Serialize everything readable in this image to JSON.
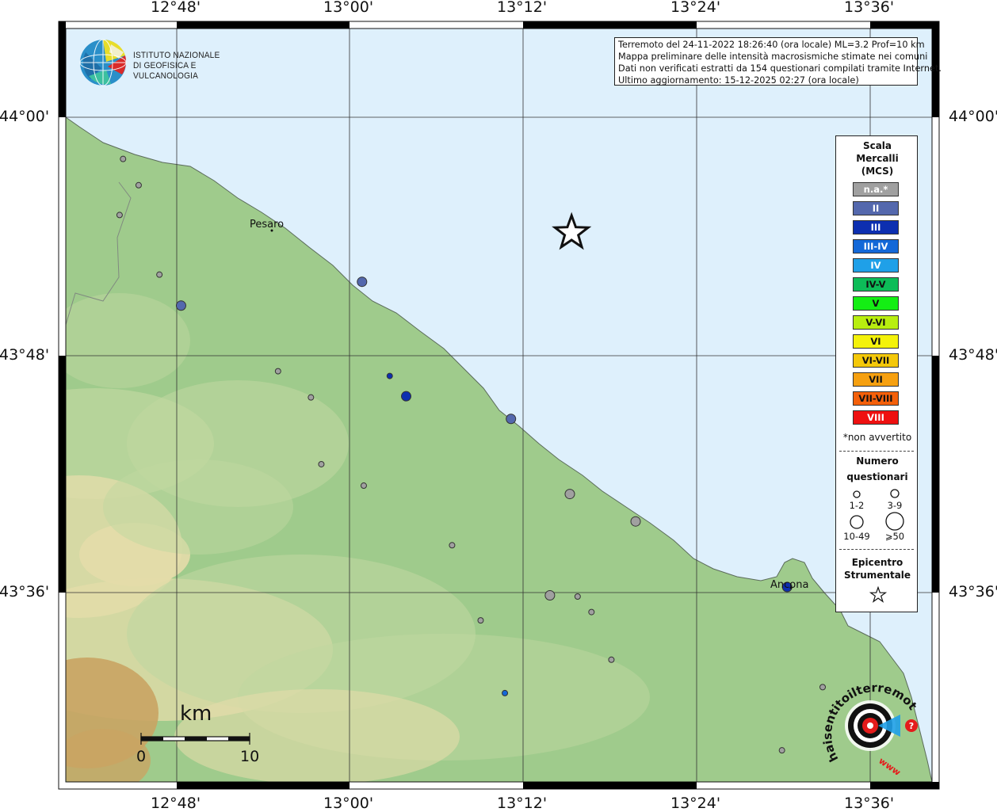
{
  "info_box": {
    "lines": [
      "Terremoto del 24-11-2022 18:26:40 (ora locale) ML=3.2 Prof=10 km",
      "Mappa preliminare delle intensità macrosismiche stimate nei comuni",
      "Dati non verificati estratti da 154 questionari compilati tramite Internet.",
      "Ultimo aggiornamento: 15-12-2025 02:27 (ora locale)"
    ]
  },
  "logo": {
    "line1": "ISTITUTO NAZIONALE",
    "line2": "DI GEOFISICA E VULCANOLOGIA"
  },
  "axes": {
    "longitudes": [
      "12°48'",
      "13°00'",
      "13°12'",
      "13°24'",
      "13°36'"
    ],
    "latitudes": [
      "44°00'",
      "43°48'",
      "43°36'"
    ]
  },
  "places": {
    "pesaro": "Pesaro",
    "ancona": "Ancona"
  },
  "legend": {
    "title": [
      "Scala",
      "Mercalli",
      "(MCS)"
    ],
    "classes": [
      {
        "label": "n.a.*",
        "color": "#a0a0a0",
        "text": "#ffffff"
      },
      {
        "label": "II",
        "color": "#5468ad",
        "text": "#ffffff"
      },
      {
        "label": "III",
        "color": "#0d2fb0",
        "text": "#ffffff"
      },
      {
        "label": "III-IV",
        "color": "#1368d8",
        "text": "#ffffff"
      },
      {
        "label": "IV",
        "color": "#1fa0e8",
        "text": "#ffffff"
      },
      {
        "label": "IV-V",
        "color": "#0dbc58",
        "text": "#111111"
      },
      {
        "label": "V",
        "color": "#14ee14",
        "text": "#111111"
      },
      {
        "label": "V-VI",
        "color": "#b8ee10",
        "text": "#111111"
      },
      {
        "label": "VI",
        "color": "#f4f20a",
        "text": "#111111"
      },
      {
        "label": "VI-VII",
        "color": "#f4c80a",
        "text": "#111111"
      },
      {
        "label": "VII",
        "color": "#f6a010",
        "text": "#111111"
      },
      {
        "label": "VII-VIII",
        "color": "#f4600a",
        "text": "#111111"
      },
      {
        "label": "VIII",
        "color": "#ee1010",
        "text": "#ffffff"
      }
    ],
    "note": "*non avvertito",
    "questionari_title": [
      "Numero",
      "questionari"
    ],
    "sizes": [
      "1-2",
      "3-9",
      "10-49",
      "⩾50"
    ],
    "epicentro_title": [
      "Epicentro",
      "Strumentale"
    ]
  },
  "scalebar": {
    "unit": "km",
    "start": "0",
    "end": "10"
  },
  "hsit_logo": {
    "text": "haisentitoilterremoto.it",
    "www": "www."
  },
  "observations": [
    {
      "lon": 12.738,
      "lat": 43.965,
      "mcs": "n.a.",
      "q": "1-2"
    },
    {
      "lon": 12.756,
      "lat": 43.943,
      "mcs": "n.a.",
      "q": "1-2"
    },
    {
      "lon": 12.734,
      "lat": 43.918,
      "mcs": "n.a.",
      "q": "1-2"
    },
    {
      "lon": 12.78,
      "lat": 43.868,
      "mcs": "n.a.",
      "q": "1-2"
    },
    {
      "lon": 12.805,
      "lat": 43.842,
      "mcs": "II",
      "q": "3-9"
    },
    {
      "lon": 13.014,
      "lat": 43.862,
      "mcs": "II",
      "q": "3-9"
    },
    {
      "lon": 12.917,
      "lat": 43.787,
      "mcs": "n.a.",
      "q": "1-2"
    },
    {
      "lon": 13.046,
      "lat": 43.783,
      "mcs": "III",
      "q": "1-2"
    },
    {
      "lon": 13.065,
      "lat": 43.766,
      "mcs": "III",
      "q": "3-9"
    },
    {
      "lon": 12.955,
      "lat": 43.765,
      "mcs": "n.a.",
      "q": "1-2"
    },
    {
      "lon": 13.186,
      "lat": 43.747,
      "mcs": "II",
      "q": "3-9"
    },
    {
      "lon": 12.967,
      "lat": 43.709,
      "mcs": "n.a.",
      "q": "1-2"
    },
    {
      "lon": 13.016,
      "lat": 43.691,
      "mcs": "n.a.",
      "q": "1-2"
    },
    {
      "lon": 13.118,
      "lat": 43.641,
      "mcs": "n.a.",
      "q": "1-2"
    },
    {
      "lon": 13.254,
      "lat": 43.684,
      "mcs": "n.a.",
      "q": "3-9"
    },
    {
      "lon": 13.231,
      "lat": 43.599,
      "mcs": "n.a.",
      "q": "3-9"
    },
    {
      "lon": 13.263,
      "lat": 43.598,
      "mcs": "n.a.",
      "q": "1-2"
    },
    {
      "lon": 13.279,
      "lat": 43.585,
      "mcs": "n.a.",
      "q": "1-2"
    },
    {
      "lon": 13.33,
      "lat": 43.661,
      "mcs": "n.a.",
      "q": "3-9"
    },
    {
      "lon": 13.505,
      "lat": 43.606,
      "mcs": "III",
      "q": "3-9"
    },
    {
      "lon": 13.151,
      "lat": 43.578,
      "mcs": "n.a.",
      "q": "1-2"
    },
    {
      "lon": 13.302,
      "lat": 43.545,
      "mcs": "n.a.",
      "q": "1-2"
    },
    {
      "lon": 13.179,
      "lat": 43.517,
      "mcs": "III-IV",
      "q": "1-2"
    },
    {
      "lon": 13.546,
      "lat": 43.522,
      "mcs": "n.a.",
      "q": "1-2"
    },
    {
      "lon": 13.499,
      "lat": 43.469,
      "mcs": "n.a.",
      "q": "1-2"
    }
  ],
  "epicenter": {
    "lon": 13.256,
    "lat": 43.903
  },
  "colors": {
    "sea": "#def0fc",
    "land_low": "#9fcb8c",
    "land_mid": "#c0d7a0",
    "land_high": "#e4dcaa",
    "land_peak": "#c9a463",
    "grid": "#333333",
    "border_black": "#000000"
  }
}
